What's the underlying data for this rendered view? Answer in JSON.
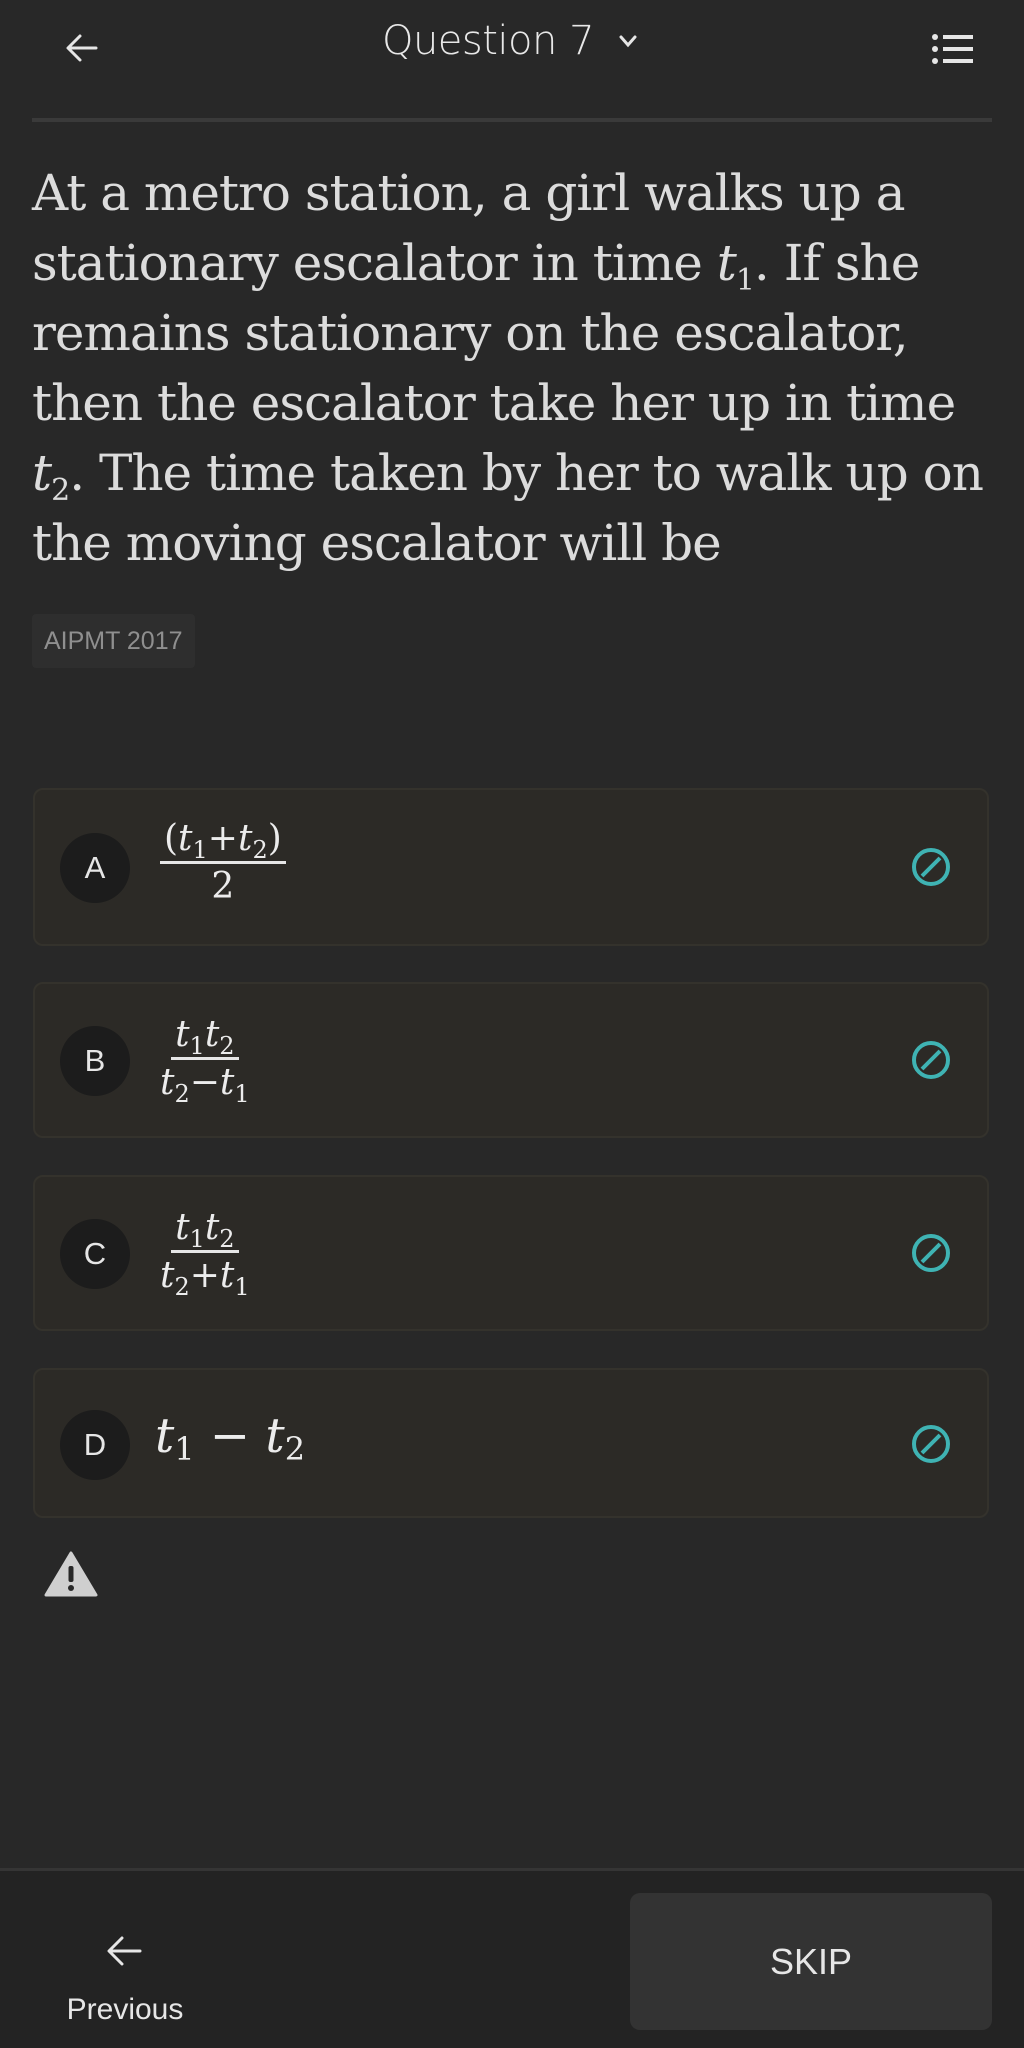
{
  "header": {
    "title": "Question 7",
    "back_icon": "arrow-left-icon",
    "dropdown_icon": "chevron-down-icon",
    "menu_icon": "question-list-icon"
  },
  "question": {
    "part1": "At a metro station, a girl walks up a stationary escalator in time ",
    "var1": "t",
    "sub1": "1",
    "part2": ". If she remains stationary on the escalator, then the escalator take her up in time ",
    "var2": "t",
    "sub2": "2",
    "part3": ". The time taken by her to walk up on the moving escalator will be",
    "tag": "AIPMT 2017"
  },
  "options": [
    {
      "letter": "A",
      "numerator": "(t1+t2)",
      "denominator": "2",
      "status_icon": "not-attempted-icon"
    },
    {
      "letter": "B",
      "numerator": "t1t2",
      "denominator": "t2−t1",
      "status_icon": "not-attempted-icon"
    },
    {
      "letter": "C",
      "numerator": "t1t2",
      "denominator": "t2+t1",
      "status_icon": "not-attempted-icon"
    },
    {
      "letter": "D",
      "expression": "t1 − t2",
      "status_icon": "not-attempted-icon"
    }
  ],
  "report_icon": "warning-icon",
  "footer": {
    "previous_label": "Previous",
    "skip_label": "SKIP"
  },
  "colors": {
    "background": "#282828",
    "option_bg": "#2c2a26",
    "status_icon": "#3fb3b3",
    "skip_bg": "#333333"
  }
}
